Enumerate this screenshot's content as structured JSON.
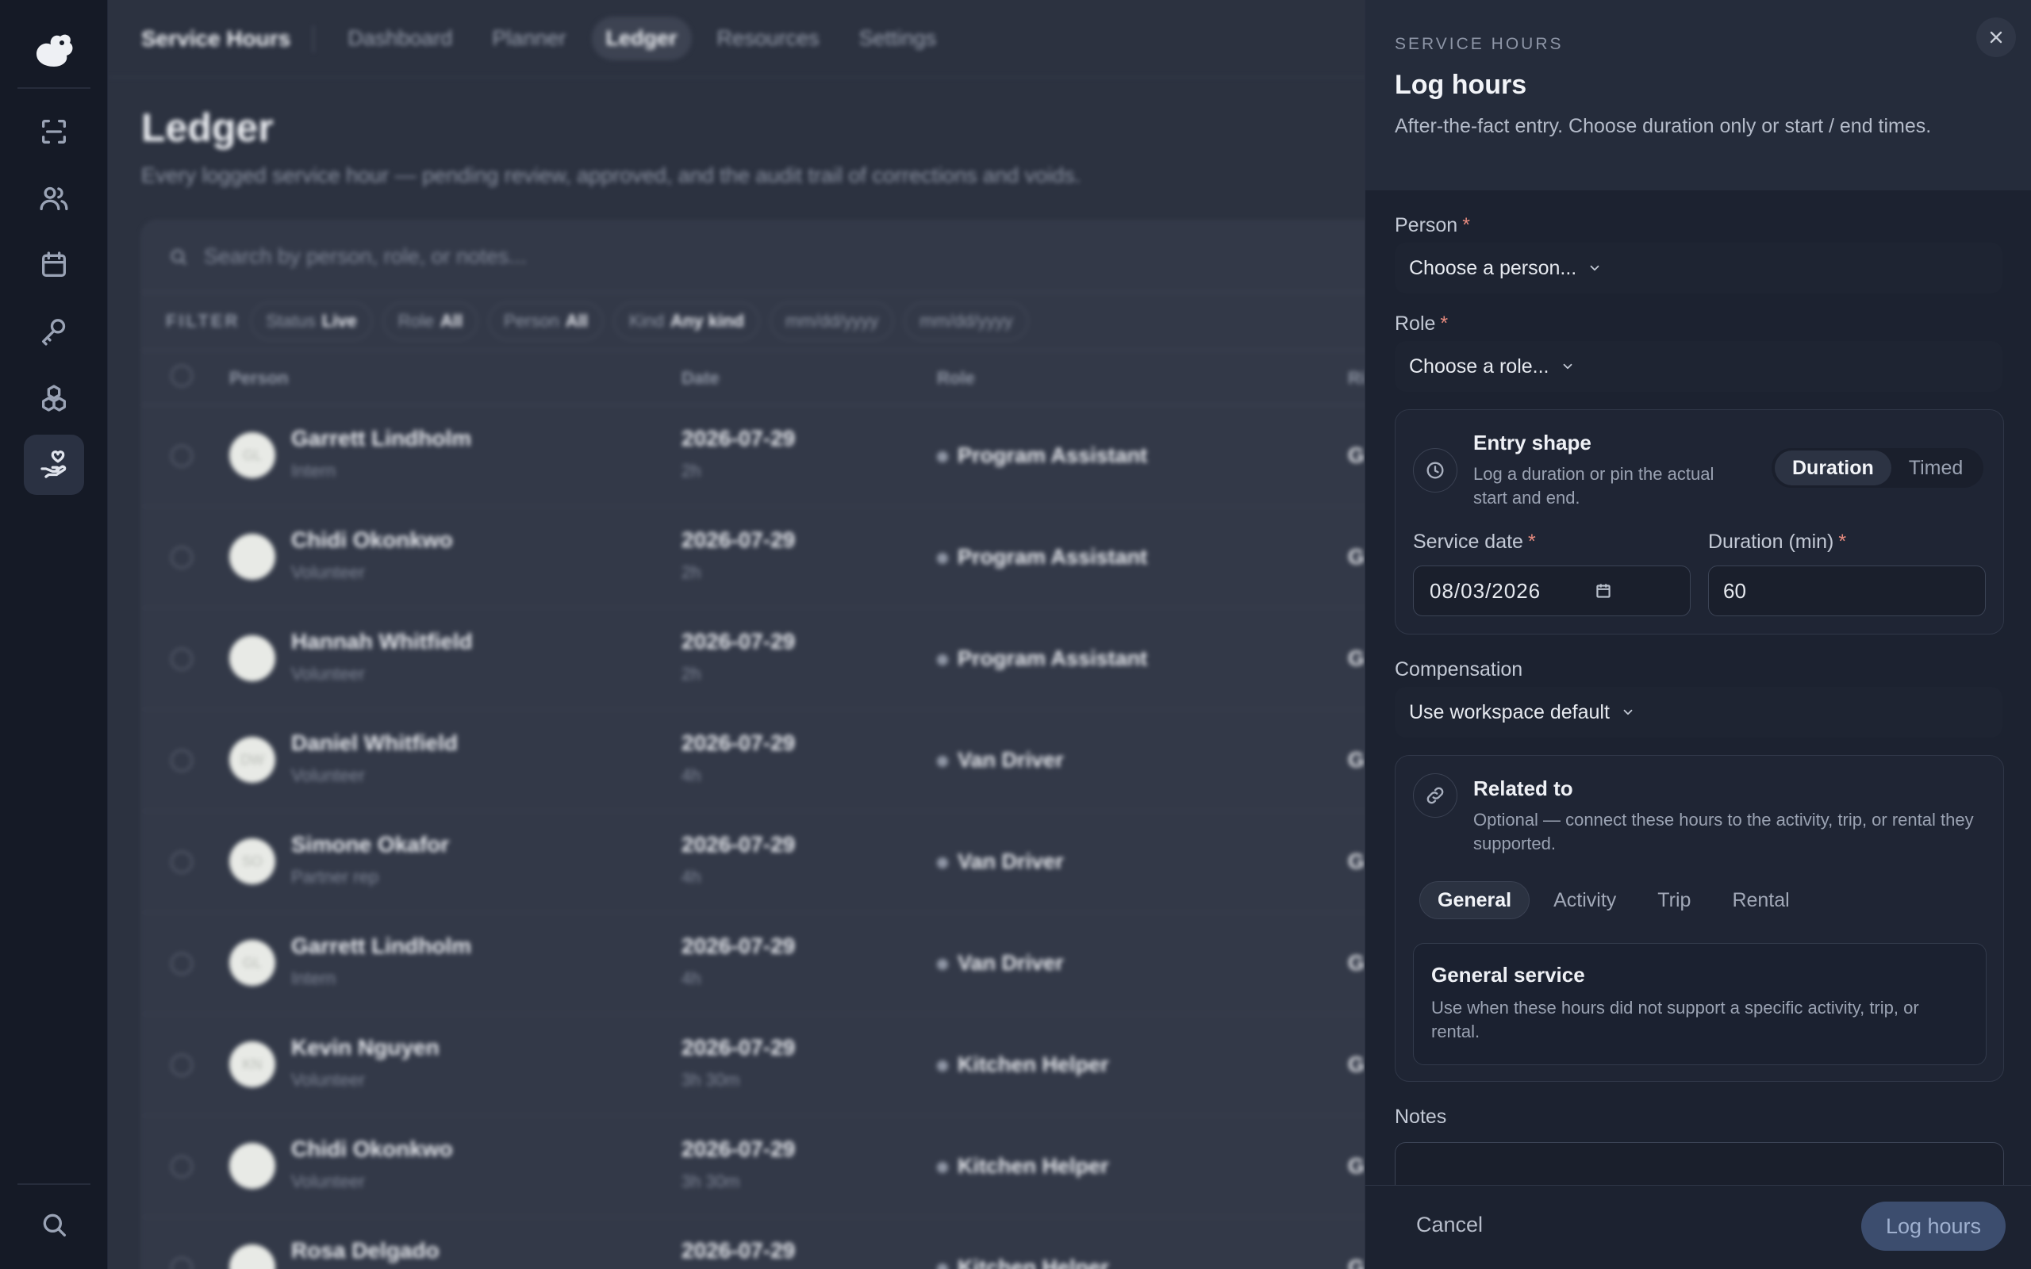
{
  "rail": {
    "items": [
      {
        "name": "scan-icon"
      },
      {
        "name": "users-icon"
      },
      {
        "name": "calendar-icon"
      },
      {
        "name": "key-icon"
      },
      {
        "name": "boxes-icon"
      },
      {
        "name": "hand-heart-icon",
        "active": true
      }
    ],
    "bottom": {
      "name": "search-icon"
    }
  },
  "app": {
    "brand": "Service Hours",
    "nav": [
      {
        "label": "Dashboard"
      },
      {
        "label": "Planner"
      },
      {
        "label": "Ledger",
        "active": true
      },
      {
        "label": "Resources"
      },
      {
        "label": "Settings"
      }
    ],
    "page_title": "Ledger",
    "page_subtitle": "Every logged service hour — pending review, approved, and the audit trail of corrections and voids.",
    "search_placeholder": "Search by person, role, or notes...",
    "filter_label": "FILTER",
    "filters": [
      {
        "label": "Status",
        "value": "Live"
      },
      {
        "label": "Role",
        "value": "All"
      },
      {
        "label": "Person",
        "value": "All"
      },
      {
        "label": "Kind",
        "value": "Any kind"
      }
    ],
    "date_from": "mm/dd/yyyy",
    "date_to": "mm/dd/yyyy",
    "columns": {
      "person": "Person",
      "date": "Date",
      "role": "Role",
      "fourth": "Ri"
    },
    "rows": [
      {
        "initials": "GL",
        "name": "Garrett Lindholm",
        "type": "Intern",
        "date": "2026-07-29",
        "duration": "2h",
        "role": "Program Assistant",
        "g": "G"
      },
      {
        "initials": "",
        "name": "Chidi Okonkwo",
        "type": "Volunteer",
        "date": "2026-07-29",
        "duration": "2h",
        "role": "Program Assistant",
        "g": "G"
      },
      {
        "initials": "",
        "name": "Hannah Whitfield",
        "type": "Volunteer",
        "date": "2026-07-29",
        "duration": "2h",
        "role": "Program Assistant",
        "g": "G"
      },
      {
        "initials": "DW",
        "name": "Daniel Whitfield",
        "type": "Volunteer",
        "date": "2026-07-29",
        "duration": "4h",
        "role": "Van Driver",
        "g": "G"
      },
      {
        "initials": "SO",
        "name": "Simone Okafor",
        "type": "Partner rep",
        "date": "2026-07-29",
        "duration": "4h",
        "role": "Van Driver",
        "g": "G"
      },
      {
        "initials": "GL",
        "name": "Garrett Lindholm",
        "type": "Intern",
        "date": "2026-07-29",
        "duration": "4h",
        "role": "Van Driver",
        "g": "G"
      },
      {
        "initials": "KN",
        "name": "Kevin Nguyen",
        "type": "Volunteer",
        "date": "2026-07-29",
        "duration": "3h 30m",
        "role": "Kitchen Helper",
        "g": "G"
      },
      {
        "initials": "",
        "name": "Chidi Okonkwo",
        "type": "Volunteer",
        "date": "2026-07-29",
        "duration": "3h 30m",
        "role": "Kitchen Helper",
        "g": "G"
      },
      {
        "initials": "",
        "name": "Rosa Delgado",
        "type": "",
        "date": "2026-07-29",
        "duration": "",
        "role": "Kitchen Helper",
        "g": "G"
      }
    ]
  },
  "drawer": {
    "eyebrow": "SERVICE HOURS",
    "title": "Log hours",
    "description": "After-the-fact entry. Choose duration only or start / end times.",
    "person_label": "Person",
    "person_value": "Choose a person...",
    "role_label": "Role",
    "role_value": "Choose a role...",
    "required_mark": "*",
    "entry_shape": {
      "title": "Entry shape",
      "description": "Log a duration or pin the actual start and end.",
      "options": [
        "Duration",
        "Timed"
      ],
      "selected": "Duration"
    },
    "service_date_label": "Service date",
    "service_date_value": "08/03/2026",
    "duration_label": "Duration (min)",
    "duration_value": "60",
    "compensation_label": "Compensation",
    "compensation_value": "Use workspace default",
    "related": {
      "title": "Related to",
      "description": "Optional — connect these hours to the activity, trip, or rental they supported.",
      "tabs": [
        "General",
        "Activity",
        "Trip",
        "Rental"
      ],
      "selected": "General",
      "box_title": "General service",
      "box_description": "Use when these hours did not support a specific activity, trip, or rental."
    },
    "notes_label": "Notes",
    "cancel_label": "Cancel",
    "submit_label": "Log hours"
  },
  "colors": {
    "accent": "#3c4d6e",
    "required": "#e58a7e",
    "drawer_bg": "#1c2230"
  }
}
